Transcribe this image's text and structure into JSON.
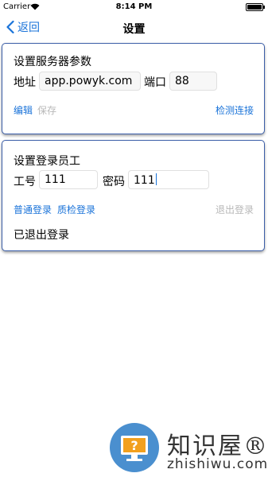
{
  "statusbar": {
    "carrier": "Carrier",
    "time": "8:14 PM"
  },
  "nav": {
    "back_label": "返回",
    "title": "设置"
  },
  "server": {
    "title": "设置服务器参数",
    "address_label": "地址",
    "address_value": "app.powyk.com",
    "port_label": "端口",
    "port_value": "88",
    "edit_label": "编辑",
    "save_label": "保存",
    "test_label": "检测连接"
  },
  "login": {
    "title": "设置登录员工",
    "id_label": "工号",
    "id_value": "111",
    "password_label": "密码",
    "password_value": "111",
    "normal_login_label": "普通登录",
    "qc_login_label": "质检登录",
    "logout_label": "退出登录",
    "status_text": "已退出登录"
  },
  "watermark": {
    "text": "知识屋®",
    "url": "zhishiwu.com"
  },
  "colors": {
    "accent": "#1a73d9",
    "disabled": "#b8b8b8",
    "card_border": "#3b5ea8"
  }
}
